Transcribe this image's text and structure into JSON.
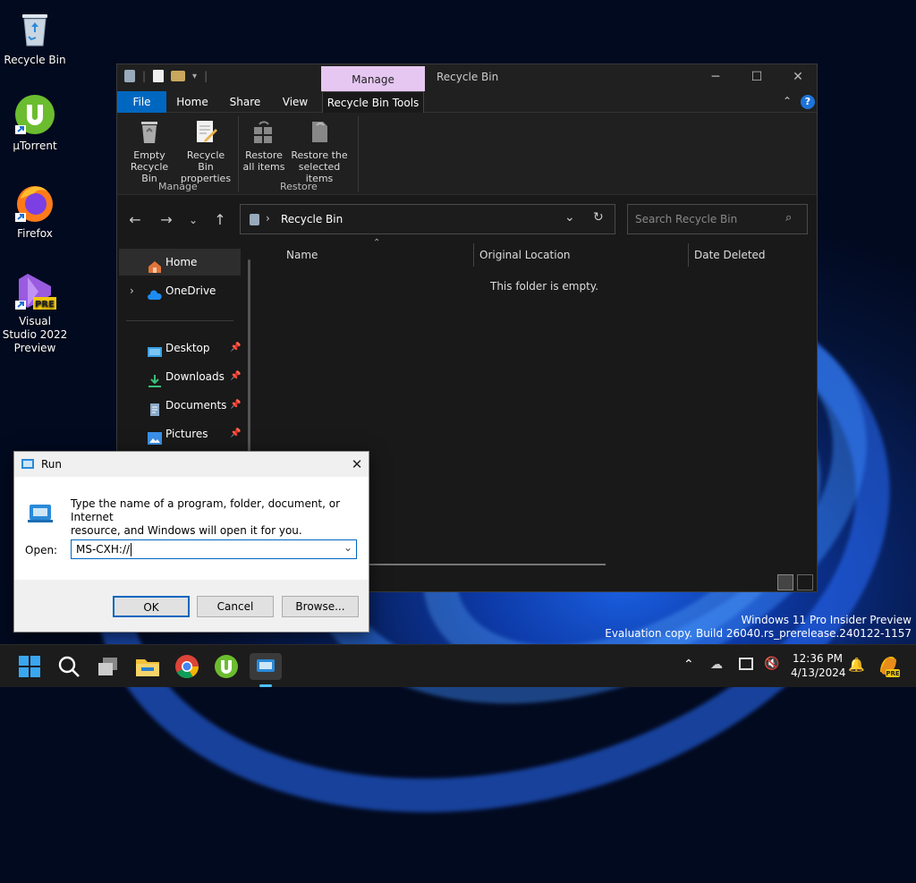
{
  "desktop": {
    "icons": [
      {
        "label": "Recycle Bin"
      },
      {
        "label": "µTorrent"
      },
      {
        "label": "Firefox"
      },
      {
        "label": "Visual Studio 2022 Preview"
      }
    ],
    "watermark_line1": "Windows 11 Pro Insider Preview",
    "watermark_line2": "Evaluation copy. Build 26040.rs_prerelease.240122-1157"
  },
  "explorer": {
    "title": "Recycle Bin",
    "context_tab": "Manage",
    "tabs": [
      "File",
      "Home",
      "Share",
      "View",
      "Recycle Bin Tools"
    ],
    "ribbon": {
      "empty_line1": "Empty",
      "empty_line2": "Recycle Bin",
      "props_line1": "Recycle Bin",
      "props_line2": "properties",
      "restore_all_line1": "Restore",
      "restore_all_line2": "all items",
      "restore_sel_line1": "Restore the",
      "restore_sel_line2": "selected items",
      "group_manage": "Manage",
      "group_restore": "Restore"
    },
    "address": "Recycle Bin",
    "search_placeholder": "Search Recycle Bin",
    "sidebar": {
      "home": "Home",
      "onedrive": "OneDrive",
      "desktop": "Desktop",
      "downloads": "Downloads",
      "documents": "Documents",
      "pictures": "Pictures"
    },
    "columns": [
      "Name",
      "Original Location",
      "Date Deleted"
    ],
    "empty_message": "This folder is empty."
  },
  "run_dialog": {
    "title": "Run",
    "description_line1": "Type the name of a program, folder, document, or Internet",
    "description_line2": "resource, and Windows will open it for you.",
    "open_label": "Open:",
    "open_value": "MS-CXH://",
    "ok": "OK",
    "cancel": "Cancel",
    "browse": "Browse..."
  },
  "taskbar": {
    "time": "12:36 PM",
    "date": "4/13/2024"
  },
  "colors": {
    "accent": "#0067c0",
    "manage_tab": "#e6c7f2"
  }
}
